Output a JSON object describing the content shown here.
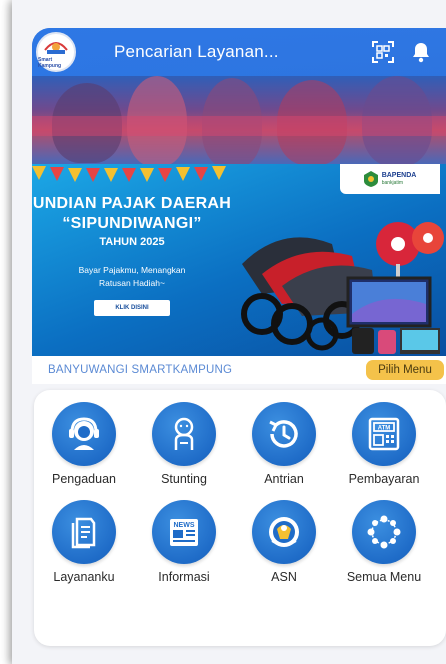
{
  "header": {
    "search_placeholder": "Pencarian Layanan...",
    "logo_caption": "Smart Kampung"
  },
  "banner": {
    "title_line1": "UNDIAN PAJAK DAERAH",
    "title_line2": "“SIPUNDIWANGI”",
    "year": "TAHUN 2025",
    "subtitle_line1": "Bayar Pajakmu, Menangkan",
    "subtitle_line2": "Ratusan Hadiah~",
    "cta_label": "KLIK DISINI",
    "sponsor_name": "BAPENDA",
    "sponsor_bank": "bankjatim"
  },
  "section": {
    "title": "BANYUWANGI SMARTKAMPUNG",
    "menu_button": "Pilih Menu"
  },
  "menu": {
    "items": [
      {
        "label": "Pengaduan",
        "icon": "customer-service-icon"
      },
      {
        "label": "Stunting",
        "icon": "baby-icon"
      },
      {
        "label": "Antrian",
        "icon": "history-clock-icon"
      },
      {
        "label": "Pembayaran",
        "icon": "atm-icon"
      },
      {
        "label": "Layananku",
        "icon": "document-icon"
      },
      {
        "label": "Informasi",
        "icon": "newspaper-icon"
      },
      {
        "label": "ASN",
        "icon": "asn-emblem-icon"
      },
      {
        "label": "Semua Menu",
        "icon": "all-menu-icon"
      }
    ]
  },
  "colors": {
    "header_blue": "#2d78e6",
    "menu_icon_blue": "#1f6cc8",
    "section_text": "#5b8ad4",
    "pilih_menu_bg": "#f4c24a"
  }
}
